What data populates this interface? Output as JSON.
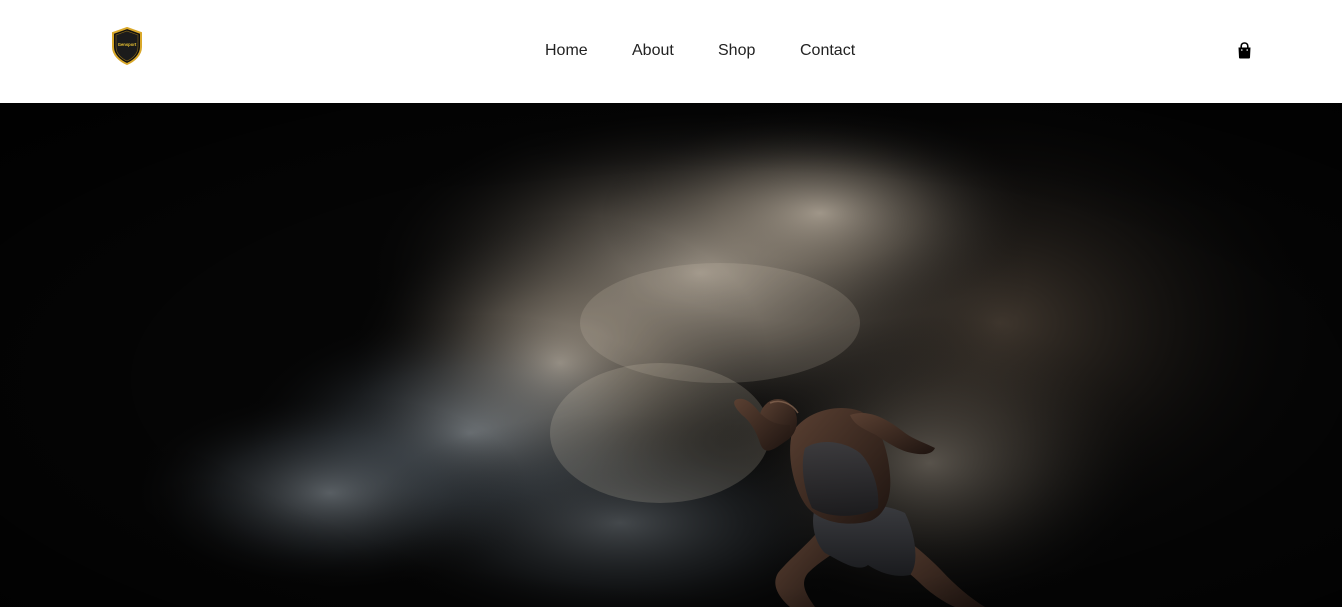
{
  "header": {
    "logo": {
      "text": "Gensport",
      "icon": "shield-logo-icon",
      "colors": {
        "shield": "#111111",
        "rim": "#d9a82a",
        "text": "#e8c232"
      }
    },
    "nav": {
      "items": [
        {
          "label": "Home"
        },
        {
          "label": "About"
        },
        {
          "label": "Shop"
        },
        {
          "label": "Contact"
        }
      ]
    },
    "cart": {
      "icon": "shopping-bag-icon"
    }
  },
  "hero": {
    "image": "sprinter-in-smoke",
    "colors": {
      "background": "#050505",
      "smoke": "#b8aa98"
    }
  }
}
